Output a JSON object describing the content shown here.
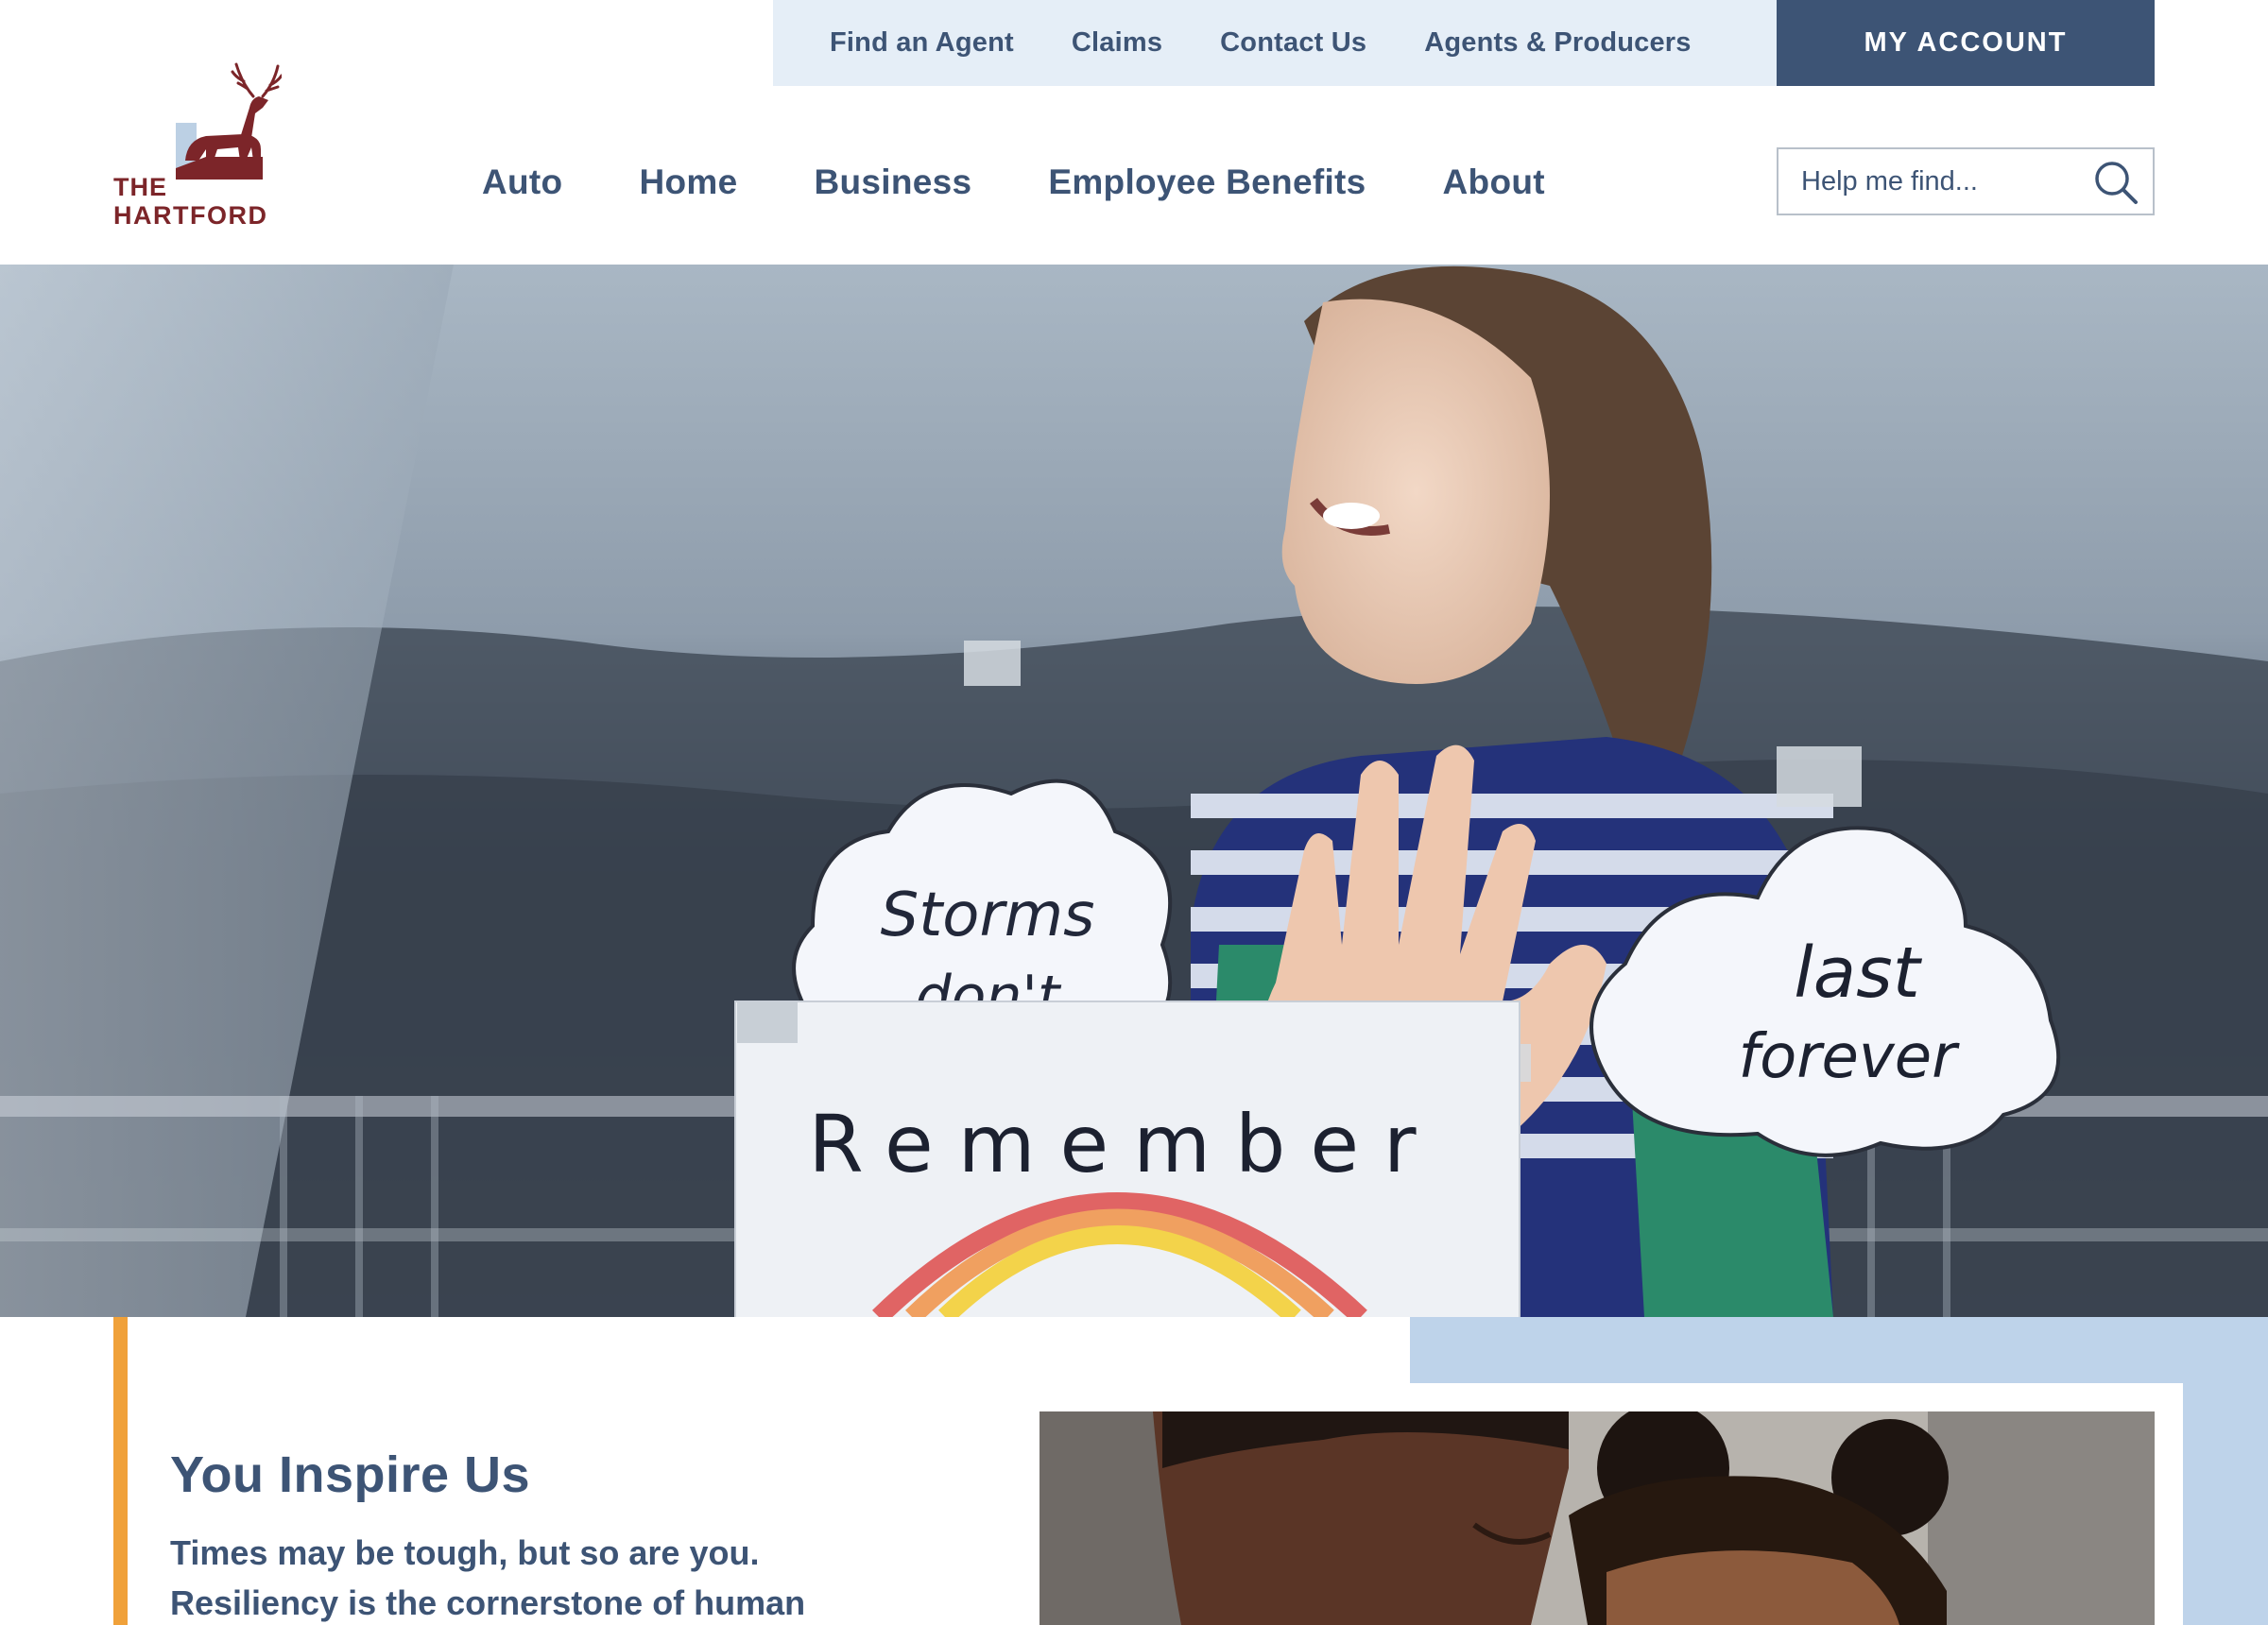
{
  "brand": {
    "line1": "THE",
    "line2": "HARTFORD",
    "logo_icon": "stag-icon",
    "color": "#7c2529"
  },
  "utility_nav": {
    "links": [
      "Find an Agent",
      "Claims",
      "Contact Us",
      "Agents & Producers"
    ],
    "account_label": "MY ACCOUNT"
  },
  "main_nav": {
    "items": [
      "Auto",
      "Home",
      "Business",
      "Employee Benefits",
      "About"
    ]
  },
  "search": {
    "placeholder": "Help me find...",
    "icon": "search-icon"
  },
  "hero": {
    "note_1": [
      "Storms",
      "don't"
    ],
    "note_2": [
      "last",
      "forever"
    ],
    "sign": "Remember"
  },
  "feature": {
    "title": "You Inspire Us",
    "body": "Times may be tough, but so are you. Resiliency is the cornerstone of human"
  },
  "colors": {
    "primary": "#3d5475",
    "utility_bg": "#e5eef7",
    "accent_orange": "#f0a13a",
    "panel_blue": "#bed3ea"
  }
}
